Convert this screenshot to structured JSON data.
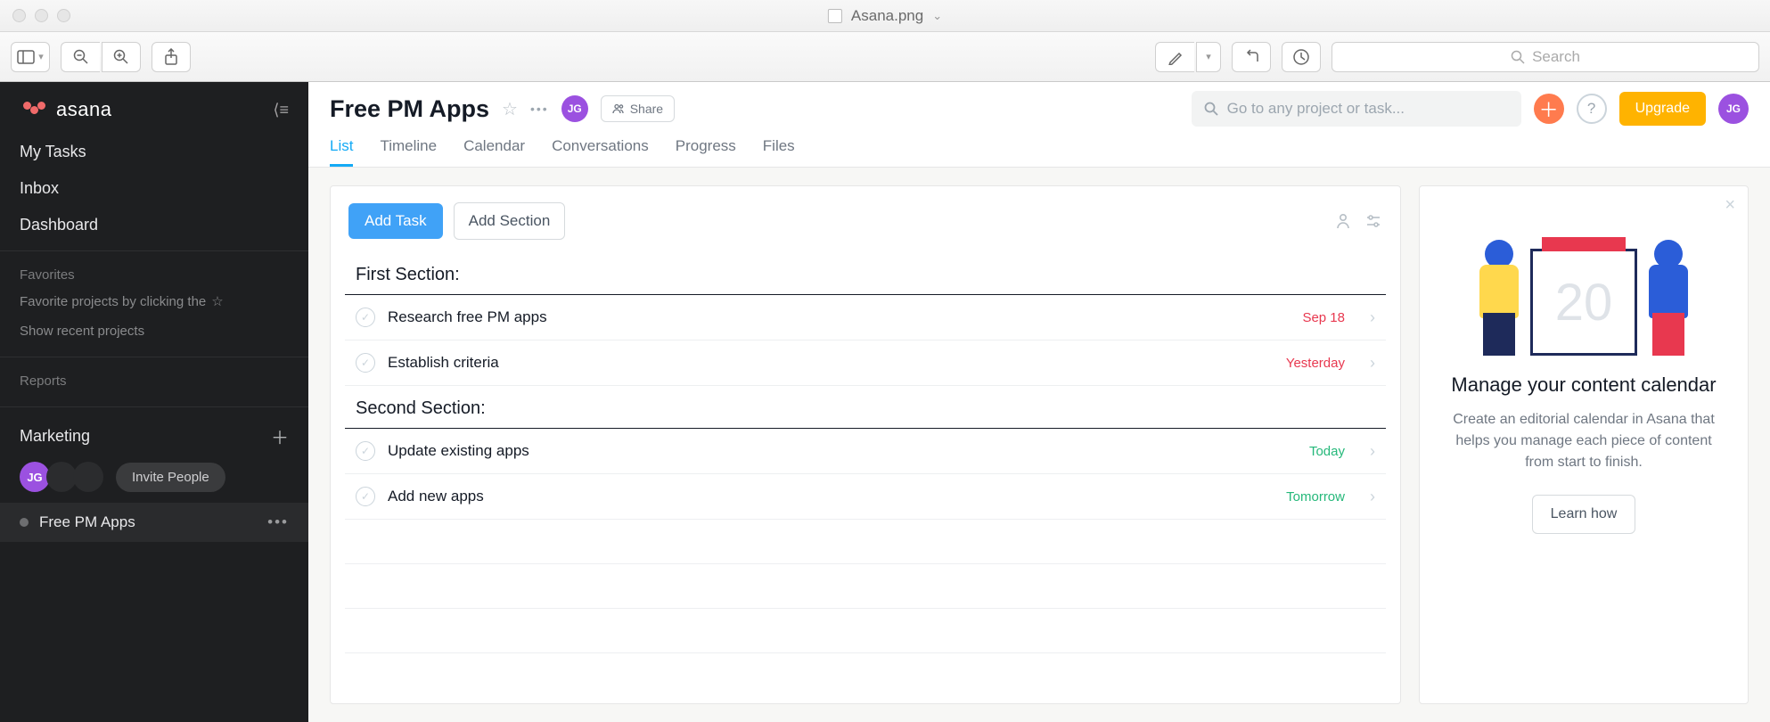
{
  "window": {
    "filename": "Asana.png",
    "search_placeholder": "Search"
  },
  "sidebar": {
    "brand": "asana",
    "nav": [
      "My Tasks",
      "Inbox",
      "Dashboard"
    ],
    "favorites_label": "Favorites",
    "favorites_hint": "Favorite projects by clicking the",
    "recent_link": "Show recent projects",
    "reports_label": "Reports",
    "team_label": "Marketing",
    "avatar_initials": "JG",
    "invite_label": "Invite People",
    "project_name": "Free PM Apps"
  },
  "header": {
    "project_title": "Free PM Apps",
    "share_label": "Share",
    "search_placeholder": "Go to any project or task...",
    "upgrade_label": "Upgrade",
    "avatar_initials": "JG",
    "tabs": [
      "List",
      "Timeline",
      "Calendar",
      "Conversations",
      "Progress",
      "Files"
    ],
    "active_tab": "List"
  },
  "tasklist": {
    "add_task_label": "Add Task",
    "add_section_label": "Add Section",
    "sections": [
      {
        "title": "First Section:",
        "tasks": [
          {
            "name": "Research free PM apps",
            "due": "Sep 18",
            "due_style": "red"
          },
          {
            "name": "Establish criteria",
            "due": "Yesterday",
            "due_style": "red"
          }
        ]
      },
      {
        "title": "Second Section:",
        "tasks": [
          {
            "name": "Update existing apps",
            "due": "Today",
            "due_style": "green"
          },
          {
            "name": "Add new apps",
            "due": "Tomorrow",
            "due_style": "green"
          }
        ]
      }
    ]
  },
  "promo": {
    "calendar_number": "20",
    "title": "Manage your content calendar",
    "body": "Create an editorial calendar in Asana that helps you manage each piece of content from start to finish.",
    "cta": "Learn how"
  }
}
